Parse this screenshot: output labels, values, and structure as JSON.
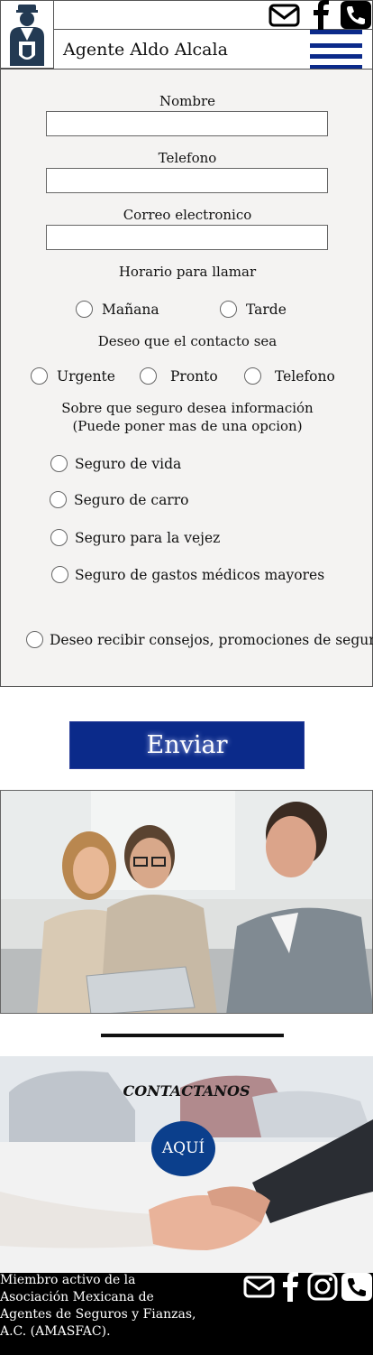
{
  "header": {
    "agent_name": "Agente Aldo Alcala",
    "icons": [
      "mail-icon",
      "facebook-icon",
      "phone-icon",
      "menu-icon"
    ]
  },
  "form": {
    "name_label": "Nombre",
    "phone_label": "Telefono",
    "email_label": "Correo electronico",
    "schedule_label": "Horario para llamar",
    "schedule_options": [
      "Mañana",
      "Tarde"
    ],
    "contact_label": "Deseo que el contacto sea",
    "contact_options": [
      "Urgente",
      "Pronto",
      "Telefono"
    ],
    "insurance_label_line1": "Sobre que seguro desea información",
    "insurance_label_line2": "(Puede poner mas de una opcion)",
    "insurance_options": [
      "Seguro de vida",
      "Seguro de carro",
      "Seguro para la vejez",
      "Seguro de gastos médicos mayores"
    ],
    "newsletter_label": "Deseo recibir consejos, promociones de seguros",
    "submit_label": "Enviar"
  },
  "contact_section": {
    "title": "CONTACTANOS",
    "button_label": "AQUÍ"
  },
  "footer": {
    "membership_text": "Miembro activo de la Asociación Mexicana de Agentes de Seguros y Fianzas, A.C. (AMASFAC).",
    "icons": [
      "mail-icon",
      "facebook-icon",
      "instagram-icon",
      "phone-icon"
    ]
  },
  "colors": {
    "brand_blue": "#0b2a8a",
    "form_background": "#f4f3f2",
    "footer_background": "#000000"
  }
}
